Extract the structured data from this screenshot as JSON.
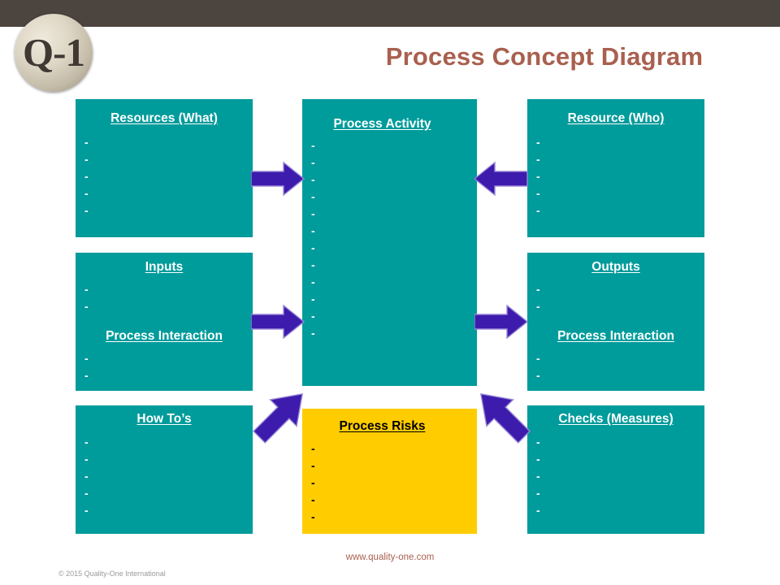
{
  "header": {
    "logo_text": "Q-1",
    "title": "Process Concept Diagram",
    "bar_color": "#4c443f",
    "title_color": "#a9604f"
  },
  "theme": {
    "teal": "#009b9b",
    "gold": "#ffcc00",
    "arrow_purple": "#3d1bad",
    "arrow_outline": "#9a88d6",
    "white": "#ffffff",
    "black": "#000000"
  },
  "boxes": {
    "resources_what": {
      "heading": "Resources (What)",
      "bullets": [
        "-",
        "-",
        "-",
        "-",
        "-"
      ],
      "fill": "#009b9b"
    },
    "process_activity": {
      "heading": "Process Activity",
      "bullets": [
        "-",
        "-",
        "-",
        "-",
        "-",
        "-",
        "-",
        "-",
        "-",
        "-",
        "-",
        "-"
      ],
      "fill": "#009b9b"
    },
    "resource_who": {
      "heading": "Resource (Who)",
      "bullets": [
        "-",
        "-",
        "-",
        "-",
        "-"
      ],
      "fill": "#009b9b"
    },
    "inputs": {
      "heading": "Inputs",
      "bullets": [
        "-",
        "-"
      ],
      "heading2": "Process Interaction",
      "bullets2": [
        "-",
        "-"
      ],
      "fill": "#009b9b"
    },
    "outputs": {
      "heading": "Outputs",
      "bullets": [
        "-",
        "-"
      ],
      "heading2": "Process Interaction",
      "bullets2": [
        "-",
        "-"
      ],
      "fill": "#009b9b"
    },
    "how_tos": {
      "heading": "How To’s",
      "bullets": [
        "-",
        "-",
        "-",
        "-",
        "-"
      ],
      "fill": "#009b9b"
    },
    "process_risks": {
      "heading": "Process Risks",
      "bullets": [
        "-",
        "-",
        "-",
        "-",
        "-"
      ],
      "fill": "#ffcc00"
    },
    "checks_measures": {
      "heading": "Checks (Measures)",
      "bullets": [
        "-",
        "-",
        "-",
        "-",
        "-"
      ],
      "fill": "#009b9b"
    }
  },
  "arrows": [
    {
      "name": "resources-to-activity",
      "direction": "right"
    },
    {
      "name": "who-to-activity",
      "direction": "left"
    },
    {
      "name": "inputs-to-activity",
      "direction": "right"
    },
    {
      "name": "activity-to-outputs",
      "direction": "right"
    },
    {
      "name": "howtos-to-activity",
      "direction": "up-right"
    },
    {
      "name": "checks-to-activity",
      "direction": "up-left"
    }
  ],
  "footer": {
    "url": "www.quality-one.com",
    "copyright": "© 2015 Quality-One International"
  }
}
